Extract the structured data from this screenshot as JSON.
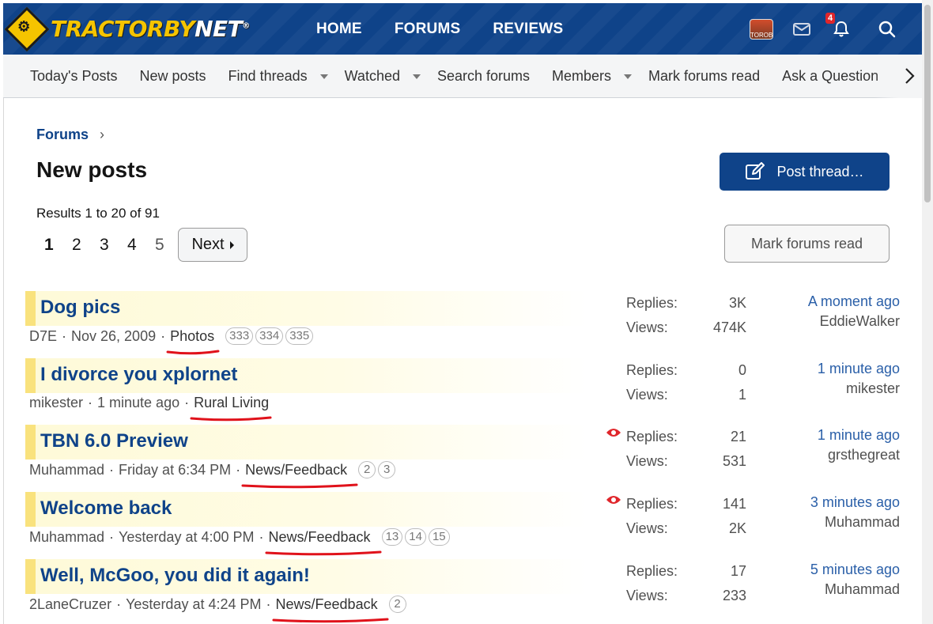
{
  "site": {
    "logo_text_main": "TRACTORBY",
    "logo_text_accent": "NET",
    "logo_mark": "®"
  },
  "main_nav": [
    "HOME",
    "FORUMS",
    "REVIEWS"
  ],
  "header_icons": {
    "avatar_label": "TOROB",
    "notifications_count": "4"
  },
  "sub_nav": [
    {
      "label": "Today's Posts",
      "has_menu": false
    },
    {
      "label": "New posts",
      "has_menu": false
    },
    {
      "label": "Find threads",
      "has_menu": true
    },
    {
      "label": "Watched",
      "has_menu": true
    },
    {
      "label": "Search forums",
      "has_menu": false
    },
    {
      "label": "Members",
      "has_menu": true
    },
    {
      "label": "Mark forums read",
      "has_menu": false
    },
    {
      "label": "Ask a Question",
      "has_menu": false
    }
  ],
  "breadcrumb": {
    "label": "Forums"
  },
  "page": {
    "title": "New posts",
    "post_thread_label": "Post thread…",
    "results_text": "Results 1 to 20 of 91",
    "mark_read_label": "Mark forums read"
  },
  "pagination": {
    "pages": [
      "1",
      "2",
      "3",
      "4",
      "5"
    ],
    "current": "1",
    "next_label": "Next"
  },
  "stats_labels": {
    "replies": "Replies:",
    "views": "Views:"
  },
  "threads": [
    {
      "title": "Dog pics",
      "author": "D7E",
      "date": "Nov 26, 2009",
      "forum": "Photos",
      "pages": [
        "333",
        "334",
        "335"
      ],
      "replies": "3K",
      "views": "474K",
      "last_time": "A moment ago",
      "last_user": "EddieWalker",
      "watched": false
    },
    {
      "title": "I divorce you xplornet",
      "author": "mikester",
      "date": "1 minute ago",
      "forum": "Rural Living",
      "pages": [],
      "replies": "0",
      "views": "1",
      "last_time": "1 minute ago",
      "last_user": "mikester",
      "watched": false
    },
    {
      "title": "TBN 6.0 Preview",
      "author": "Muhammad",
      "date": "Friday at 6:34 PM",
      "forum": "News/Feedback",
      "pages": [
        "2",
        "3"
      ],
      "replies": "21",
      "views": "531",
      "last_time": "1 minute ago",
      "last_user": "grsthegreat",
      "watched": true
    },
    {
      "title": "Welcome back",
      "author": "Muhammad",
      "date": "Yesterday at 4:00 PM",
      "forum": "News/Feedback",
      "pages": [
        "13",
        "14",
        "15"
      ],
      "replies": "141",
      "views": "2K",
      "last_time": "3 minutes ago",
      "last_user": "Muhammad",
      "watched": true
    },
    {
      "title": "Well, McGoo, you did it again!",
      "author": "2LaneCruzer",
      "date": "Yesterday at 4:24 PM",
      "forum": "News/Feedback",
      "pages": [
        "2"
      ],
      "replies": "17",
      "views": "233",
      "last_time": "5 minutes ago",
      "last_user": "Muhammad",
      "watched": false
    }
  ],
  "colors": {
    "brand_blue": "#0f4389",
    "logo_yellow": "#f5c400",
    "highlight_bar": "#f9e27d",
    "annotation_red": "#e0121b",
    "link_blue": "#2a5fa8"
  }
}
